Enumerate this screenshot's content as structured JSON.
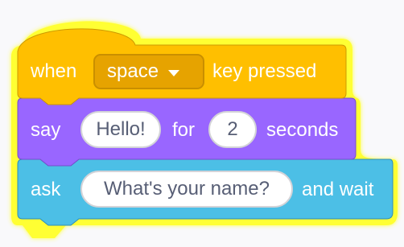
{
  "colors": {
    "events": "#ffbf00",
    "events_dark": "#e6a300",
    "looks": "#9966ff",
    "sensing": "#4cbfe6",
    "glow": "#ffff33",
    "field_text": "#575e75"
  },
  "script": {
    "hat_block": {
      "prefix": "when",
      "key_dropdown": {
        "value": "space",
        "icon": "dropdown-caret-icon"
      },
      "suffix": "key pressed"
    },
    "say_block": {
      "verb": "say",
      "message": "Hello!",
      "for_label": "for",
      "duration": "2",
      "unit": "seconds"
    },
    "ask_block": {
      "verb": "ask",
      "question": "What's your name?",
      "suffix": "and wait"
    }
  }
}
